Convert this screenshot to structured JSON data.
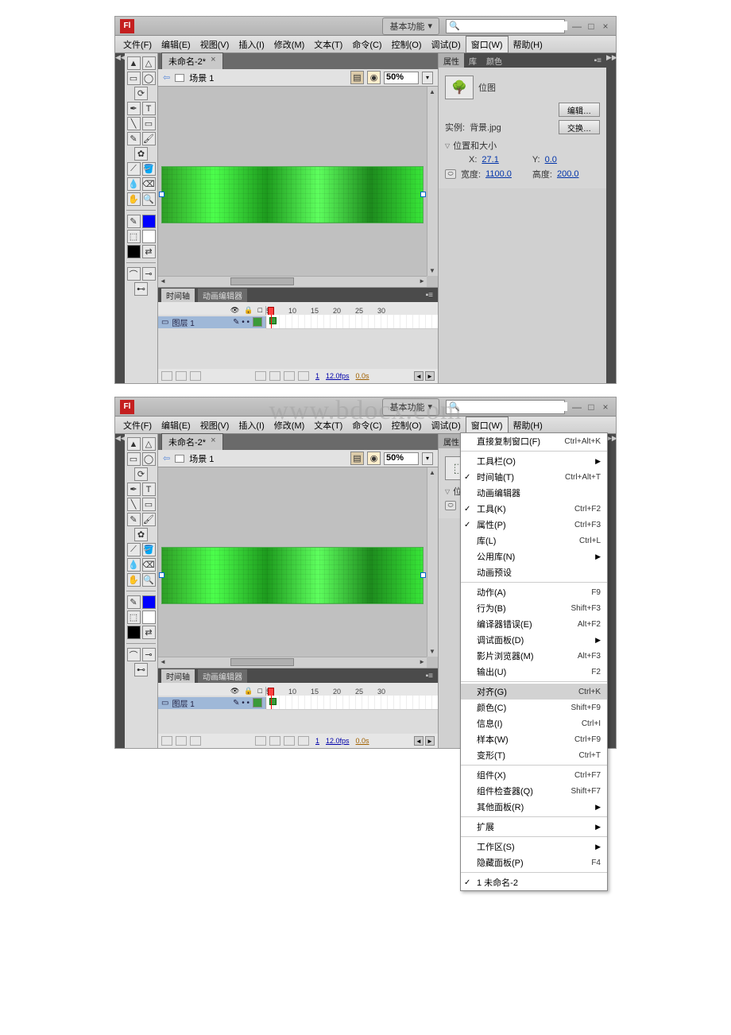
{
  "app_icon_label": "Fl",
  "workspace": {
    "label": "基本功能",
    "caret": "▾"
  },
  "search": {
    "placeholder": ""
  },
  "window_controls": {
    "min": "—",
    "max": "□",
    "close": "×"
  },
  "menubar": [
    "文件(F)",
    "编辑(E)",
    "视图(V)",
    "插入(I)",
    "修改(M)",
    "文本(T)",
    "命令(C)",
    "控制(O)",
    "调试(D)",
    "窗口(W)",
    "帮助(H)"
  ],
  "doc_tab": {
    "title": "未命名-2*",
    "close": "×"
  },
  "edit_bar": {
    "back": "⇦",
    "scene": "场景 1",
    "zoom": "50%"
  },
  "timeline": {
    "tabs": [
      "时间轴",
      "动画编辑器"
    ],
    "header_icons": [
      "👁",
      "🔒",
      "□"
    ],
    "frame_nums": [
      "5",
      "10",
      "15",
      "20",
      "25",
      "30"
    ],
    "layer_name": "图层 1",
    "foot": {
      "frame": "1",
      "fps": "12.0fps",
      "time": "0.0s"
    }
  },
  "panels": {
    "tabs": [
      "属性",
      "库",
      "颜色"
    ],
    "bitmap_label": "位图",
    "edit_btn": "编辑…",
    "instance_label": "实例:",
    "instance_value": "背景.jpg",
    "swap_btn": "交换…",
    "section": "位置和大小",
    "x_label": "X:",
    "x_value": "27.1",
    "y_label": "Y:",
    "y_value": "0.0",
    "w_label": "宽度:",
    "w_value": "1100.0",
    "h_label": "高度:",
    "h_value": "200.0"
  },
  "windowMenu": {
    "groups": [
      [
        {
          "label": "直接复制窗口(F)",
          "shortcut": "Ctrl+Alt+K"
        }
      ],
      [
        {
          "label": "工具栏(O)",
          "sub": true
        },
        {
          "label": "时间轴(T)",
          "shortcut": "Ctrl+Alt+T",
          "check": true
        },
        {
          "label": "动画编辑器"
        },
        {
          "label": "工具(K)",
          "shortcut": "Ctrl+F2",
          "check": true
        },
        {
          "label": "属性(P)",
          "shortcut": "Ctrl+F3",
          "check": true
        },
        {
          "label": "库(L)",
          "shortcut": "Ctrl+L"
        },
        {
          "label": "公用库(N)",
          "sub": true
        },
        {
          "label": "动画预设"
        }
      ],
      [
        {
          "label": "动作(A)",
          "shortcut": "F9"
        },
        {
          "label": "行为(B)",
          "shortcut": "Shift+F3"
        },
        {
          "label": "编译器错误(E)",
          "shortcut": "Alt+F2"
        },
        {
          "label": "调试面板(D)",
          "sub": true
        },
        {
          "label": "影片浏览器(M)",
          "shortcut": "Alt+F3"
        },
        {
          "label": "输出(U)",
          "shortcut": "F2"
        }
      ],
      [
        {
          "label": "对齐(G)",
          "shortcut": "Ctrl+K",
          "hl": true
        },
        {
          "label": "颜色(C)",
          "shortcut": "Shift+F9"
        },
        {
          "label": "信息(I)",
          "shortcut": "Ctrl+I"
        },
        {
          "label": "样本(W)",
          "shortcut": "Ctrl+F9"
        },
        {
          "label": "变形(T)",
          "shortcut": "Ctrl+T"
        }
      ],
      [
        {
          "label": "组件(X)",
          "shortcut": "Ctrl+F7"
        },
        {
          "label": "组件检查器(Q)",
          "shortcut": "Shift+F7"
        },
        {
          "label": "其他面板(R)",
          "sub": true
        }
      ],
      [
        {
          "label": "扩展",
          "sub": true
        }
      ],
      [
        {
          "label": "工作区(S)",
          "sub": true
        },
        {
          "label": "隐藏面板(P)",
          "shortcut": "F4"
        }
      ],
      [
        {
          "label": "1 未命名-2",
          "check": true
        }
      ]
    ]
  },
  "watermark": "www.bdocx.com"
}
